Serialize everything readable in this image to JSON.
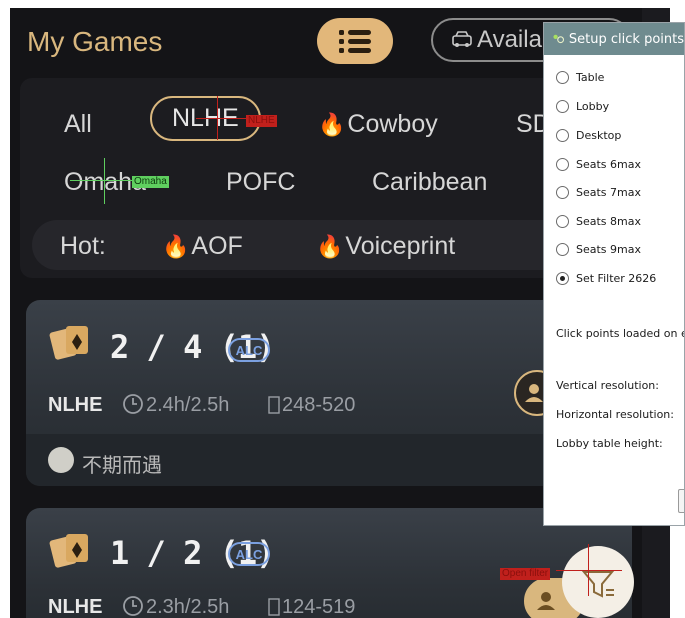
{
  "app": {
    "title": "My Games",
    "available_label": "Availab",
    "tabs": [
      "All",
      "NLHE",
      "Cowboy",
      "SD",
      "Omaha",
      "POFC",
      "Caribbean"
    ],
    "hot_label": "Hot:",
    "hot_items": [
      "AOF",
      "Voiceprint"
    ],
    "overlay_tags": {
      "nlhe": "NLHE",
      "omaha": "Omaha",
      "open_filter": "Open filter"
    },
    "cards": [
      {
        "stakes": "2 / 4 (1)",
        "badge": "ALC",
        "game": "NLHE",
        "time": "2.4h/2.5h",
        "range": "248-520",
        "player": "不期而遇"
      },
      {
        "stakes": "1 / 2 (1)",
        "badge": "ALC",
        "game": "NLHE",
        "time": "2.3h/2.5h",
        "range": "124-519"
      }
    ]
  },
  "setup_dialog": {
    "title": "Setup click points",
    "options": [
      "Table",
      "Lobby",
      "Desktop",
      "Seats 6max",
      "Seats 7max",
      "Seats 8max",
      "Seats 9max",
      "Set Filter 2626"
    ],
    "selected_index": 7,
    "info_text": "Click points loaded on em",
    "vertical_label": "Vertical resolution:",
    "horizontal_label": "Horizontal resolution:",
    "lobby_height_label": "Lobby table height:"
  },
  "colors": {
    "gold": "#d9b77e",
    "flame": "#ff6a3d",
    "alc_blue": "#7ba0e0",
    "dialog_title": "#6f8b8f"
  },
  "icons": [
    "list-icon",
    "car-icon",
    "flame-icon",
    "cards-icon",
    "clock-icon",
    "chip-icon",
    "user-group-icon",
    "filter-icon"
  ]
}
